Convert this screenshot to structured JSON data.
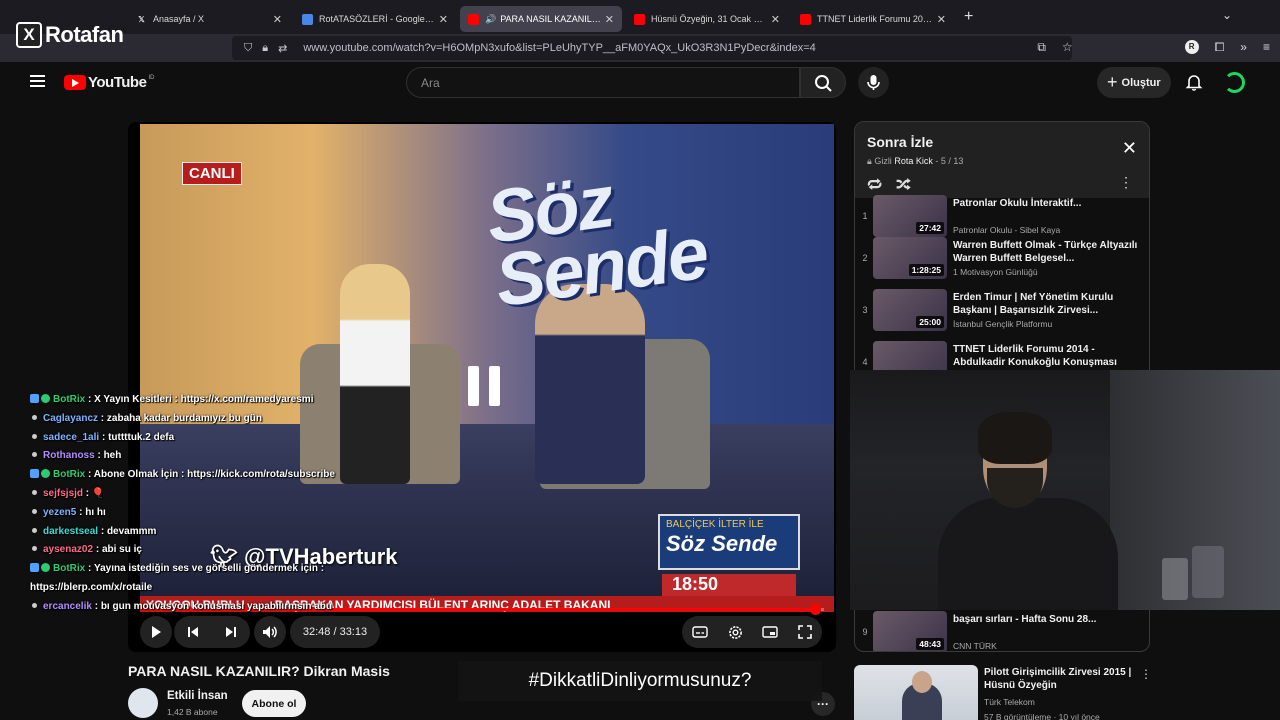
{
  "browser": {
    "tabs": [
      {
        "title": "Anasayfa / X",
        "favicon": "x-icon",
        "active": false
      },
      {
        "title": "RotATASÖZLERİ - Google Doküman",
        "favicon": "docs-icon",
        "active": false
      },
      {
        "title": "PARA NASIL KAZANILIR? Dikran Masis",
        "favicon": "youtube-icon",
        "active": true
      },
      {
        "title": "Hüsnü Özyeğin, 31 Ocak 2017 Pilott",
        "favicon": "youtube-icon",
        "active": false
      },
      {
        "title": "TTNET Liderlik Forumu 2014 - Abdulkadir",
        "favicon": "youtube-icon",
        "active": false
      }
    ],
    "url": "www.youtube.com/watch?v=H6OMpN3xufo&list=PLeUhyTYP__aFM0YAQx_UkO3R3N1PyDecr&index=4",
    "profile_letter": "R"
  },
  "watermark": {
    "letter": "X",
    "text": "Rotafan"
  },
  "youtube": {
    "logo_text": "YouTube",
    "logo_region": "ID",
    "search_placeholder": "Ara",
    "create_label": "Oluştur"
  },
  "player": {
    "current_time": "32:48",
    "duration": "33:13",
    "time_display": "32:48 / 33:13",
    "progress_fraction": 0.987,
    "overlay": {
      "live_label": "CANLI",
      "show_title": "Söz Sende",
      "handle": "@TVHaberturk",
      "badge_host": "BALÇİÇEK İLTER İLE",
      "badge_show": "Söz Sende",
      "clock": "18:50",
      "ticker": "BAŞBAKAN YARDIMCISI BÜLENT ARINÇ ADALET BAKANI",
      "bg_caption": "YOUGOU BUBLU"
    }
  },
  "chat": [
    {
      "user": "BotRix",
      "msg": "X Yayın Kesitleri : https://x.com/ramedyaresmi",
      "user_color": "#2ecc71",
      "bot": true
    },
    {
      "user": "Caglayancz",
      "msg": "zabaha kadar burdamıyız bu gün",
      "user_color": "#7fb2ff",
      "bot": false
    },
    {
      "user": "sadece_1ali",
      "msg": "tuttttuk.2 defa",
      "user_color": "#7fb2ff",
      "bot": false
    },
    {
      "user": "Rothanoss",
      "msg": "heh",
      "user_color": "#b38cff",
      "bot": false
    },
    {
      "user": "BotRix",
      "msg": "Abone Olmak İçin : https://kick.com/rota/subscribe",
      "user_color": "#2ecc71",
      "bot": true
    },
    {
      "user": "sejfsjsjd",
      "msg": "🎈",
      "user_color": "#ff6b8b",
      "bot": false
    },
    {
      "user": "yezen5",
      "msg": "hı hı",
      "user_color": "#7fb2ff",
      "bot": false
    },
    {
      "user": "darkestseal",
      "msg": "devammm",
      "user_color": "#3ddbd9",
      "bot": false
    },
    {
      "user": "aysenaz02",
      "msg": "abi su iç",
      "user_color": "#ff6b8b",
      "bot": false
    },
    {
      "user": "BotRix",
      "msg": "Yayına istediğin ses ve görselli göndermek için :",
      "user_color": "#2ecc71",
      "bot": true
    },
    {
      "user": "",
      "msg": "https://blerp.com/x/rotaile",
      "user_color": "#ffffff",
      "bot": false,
      "continuation": true
    },
    {
      "user": "ercancelik",
      "msg": "bı gun motıvasyon konusması yapabılırmsın abu",
      "user_color": "#b38cff",
      "bot": false
    }
  ],
  "playlist": {
    "title": "Sonra İzle",
    "privacy": "Gizli",
    "owner": "Rota Kick",
    "position": "5 / 13",
    "items": [
      {
        "index": "1",
        "title": "Patronlar Okulu İnteraktif...",
        "channel": "Patronlar Okulu - Sibel Kaya",
        "duration": "27:42"
      },
      {
        "index": "2",
        "title": "Warren Buffett Olmak - Türkçe Altyazılı Warren Buffett Belgesel...",
        "channel": "1 Motivasyon Günlüğü",
        "duration": "1:28:25"
      },
      {
        "index": "3",
        "title": "Erden Timur | Nef Yönetim Kurulu Başkanı | Başarısızlık Zirvesi...",
        "channel": "İstanbul Gençlik Platformu",
        "duration": "25:00"
      },
      {
        "index": "4",
        "title": "TTNET Liderlik Forumu 2014 - Abdulkadir Konukoğlu Konuşması",
        "channel": "",
        "duration": ""
      },
      {
        "index": "9",
        "title": "başarı sırları - Hafta Sonu 28...",
        "channel": "CNN TÜRK",
        "duration": "48:43"
      }
    ]
  },
  "video": {
    "title": "PARA NASIL KAZANILIR? Dikran Masis",
    "channel": "Etkili İnsan",
    "subscribers": "1,42 B abone",
    "subscribe_label": "Abone ol"
  },
  "hashtag": "#DikkatliDinliyormusunuz?",
  "recommendation": {
    "title": "Pilott Girişimcilik Zirvesi 2015 | Hüsnü Özyeğin",
    "channel": "Türk Telekom",
    "meta": "57 B görüntüleme · 10 yıl önce"
  }
}
